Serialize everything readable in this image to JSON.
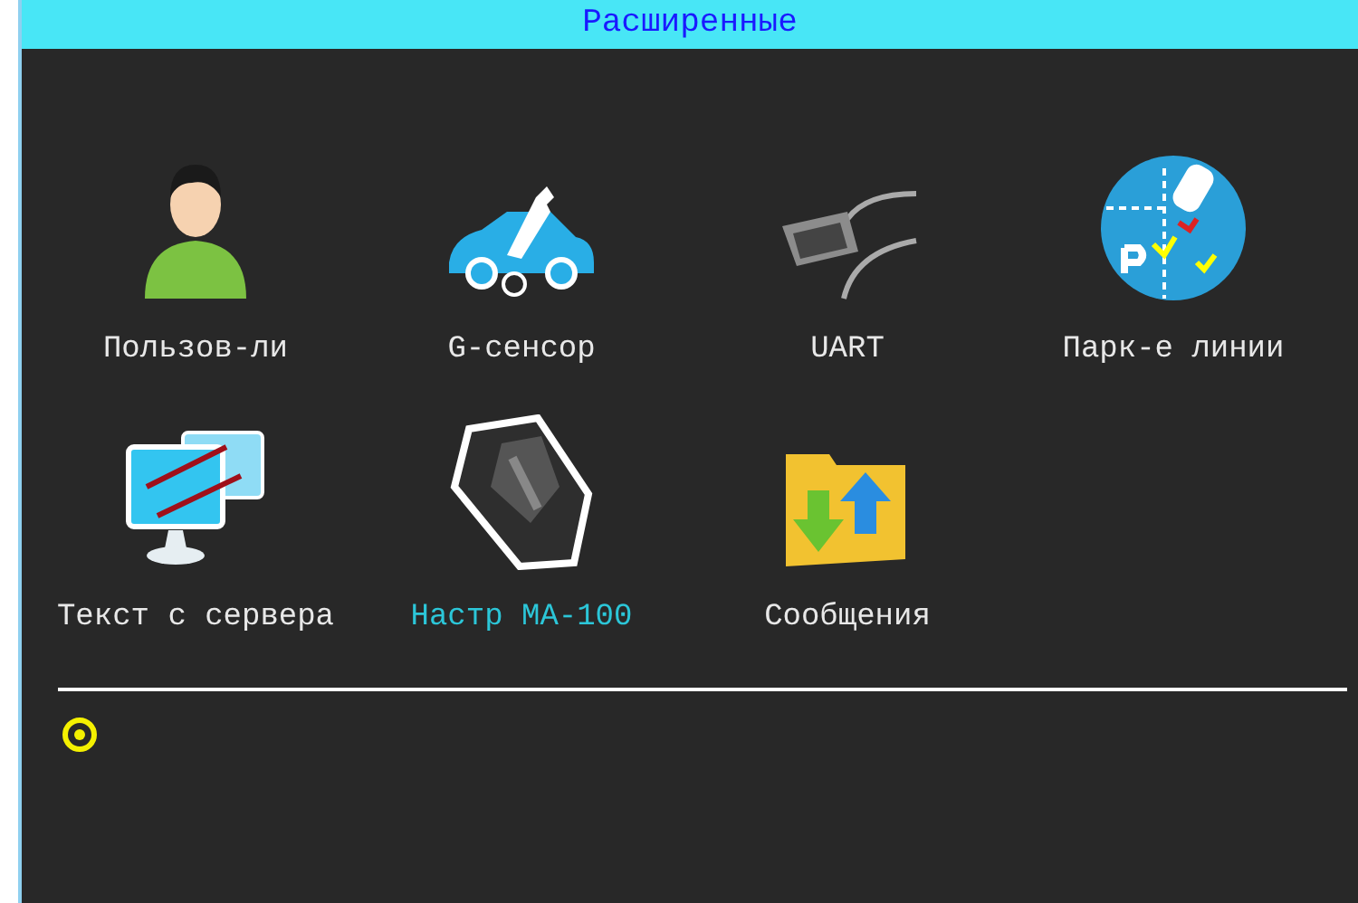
{
  "window": {
    "title": "Расширенные"
  },
  "items": [
    {
      "label": "Пользов-ли",
      "kind": "user",
      "selected": false
    },
    {
      "label": "G-сенсор",
      "kind": "car",
      "selected": false
    },
    {
      "label": "UART",
      "kind": "cable",
      "selected": false
    },
    {
      "label": "Парк-е линии",
      "kind": "parking",
      "selected": false
    },
    {
      "label": "Текст с сервера",
      "kind": "monitors",
      "selected": false
    },
    {
      "label": "Настр MA-100",
      "kind": "device",
      "selected": true
    },
    {
      "label": "Сообщения",
      "kind": "folder",
      "selected": false
    }
  ]
}
